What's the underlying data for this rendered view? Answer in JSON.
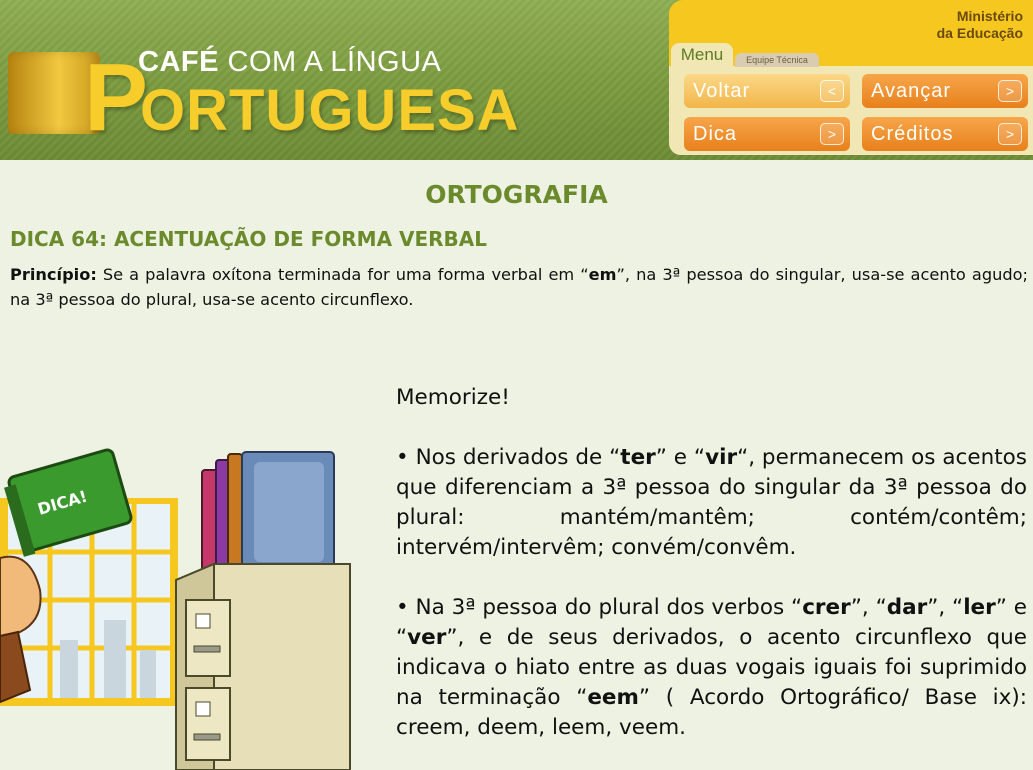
{
  "header": {
    "brand_line1_bold": "CAFÉ",
    "brand_line1_rest": " COM A LÍNGUA",
    "brand_big_initial": "P",
    "brand_big_rest": "ORTUGUESA",
    "ministry_line1": "Ministério",
    "ministry_line2": "da Educação",
    "tabs": {
      "menu": "Menu",
      "team": "Equipe Técnica"
    },
    "buttons": {
      "back": "Voltar",
      "forward": "Avançar",
      "tip": "Dica",
      "credits": "Créditos"
    }
  },
  "page": {
    "title": "ORTOGRAFIA",
    "subtitle": "DICA 64: ACENTUAÇÃO DE FORMA VERBAL",
    "principle_label": "Princípio:",
    "principle_text_a": " Se a palavra oxítona terminada for uma forma verbal em “",
    "principle_em": "em",
    "principle_text_b": "”, na 3ª pessoa do singular, usa-se acento agudo; na 3ª pessoa do plural, usa-se acento circunflexo.",
    "memorize": "Memorize!",
    "p1_a": "• Nos derivados de “",
    "p1_ter": "ter",
    "p1_b": "” e “",
    "p1_vir": "vir",
    "p1_c": "“, permanecem os acentos que diferenciam  a 3ª pessoa do singular da 3ª pessoa do plural: mantém/mantêm; contém/contêm; intervém/intervêm; convém/convêm.",
    "p2_a": "• Na 3ª  pessoa  do plural dos verbos “",
    "p2_crer": "crer",
    "p2_b": "”, “",
    "p2_dar": "dar",
    "p2_c": "”, “",
    "p2_ler": "ler",
    "p2_d": "” e “",
    "p2_ver": "ver",
    "p2_e": "”, e de seus derivados, o acento circunflexo que  indicava o hiato entre as duas vogais iguais foi suprimido  na terminação “",
    "p2_eem": "eem",
    "p2_f": "” ( Acordo Ortográfico/ Base ix): creem, deem, leem, veem."
  },
  "illustration": {
    "book_label": "DICA!"
  },
  "colors": {
    "accent_green": "#6a8a2c",
    "header_green": "#7a9a3e",
    "panel_yellow": "#f6c81f",
    "button_orange": "#e8801c"
  }
}
